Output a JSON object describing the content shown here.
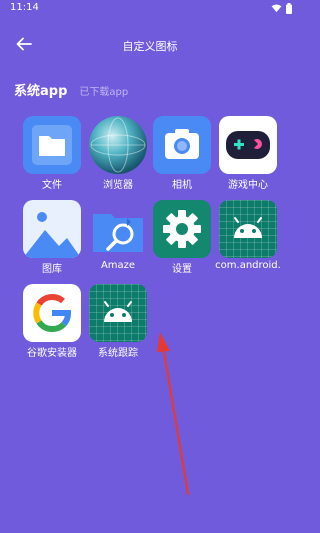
{
  "status": {
    "time": "11:14"
  },
  "header": {
    "title": "自定义图标"
  },
  "tabs": {
    "system": "系统app",
    "downloaded": "已下载app"
  },
  "apps": [
    {
      "label": "文件",
      "icon": "folder-icon"
    },
    {
      "label": "浏览器",
      "icon": "globe-icon"
    },
    {
      "label": "相机",
      "icon": "camera-icon"
    },
    {
      "label": "游戏中心",
      "icon": "gamepad-icon"
    },
    {
      "label": "图库",
      "icon": "gallery-icon"
    },
    {
      "label": "Amaze",
      "icon": "amaze-folder-icon"
    },
    {
      "label": "设置",
      "icon": "gear-icon"
    },
    {
      "label": "com.android.",
      "icon": "android-icon"
    },
    {
      "label": "谷歌安装器",
      "icon": "google-icon"
    },
    {
      "label": "系统跟踪",
      "icon": "android-icon"
    }
  ],
  "colors": {
    "background": "#6f5bdc",
    "annotation": "#e53935"
  }
}
